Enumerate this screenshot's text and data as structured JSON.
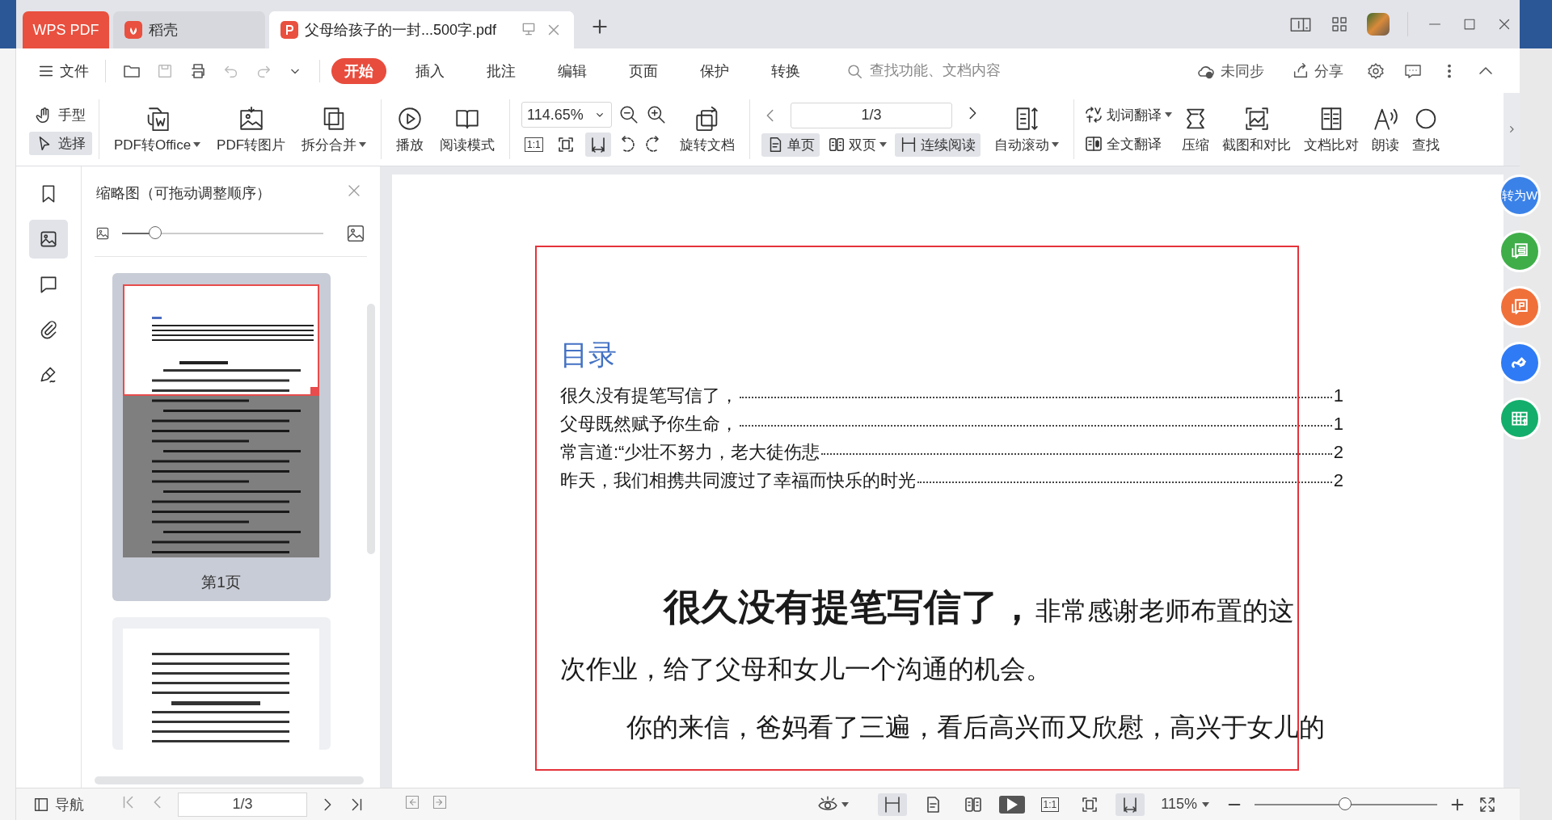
{
  "tabs": [
    {
      "kind": "brand",
      "label": "WPS PDF",
      "selected": false
    },
    {
      "kind": "store",
      "label": "稻壳",
      "selected": false
    },
    {
      "kind": "document",
      "label": "父母给孩子的一封...500字.pdf",
      "selected": true
    }
  ],
  "menu": {
    "file": "文件",
    "ribbon_tabs": [
      {
        "label": "开始",
        "selected": true
      },
      {
        "label": "插入",
        "selected": false
      },
      {
        "label": "批注",
        "selected": false
      },
      {
        "label": "编辑",
        "selected": false
      },
      {
        "label": "页面",
        "selected": false
      },
      {
        "label": "保护",
        "selected": false
      },
      {
        "label": "转换",
        "selected": false
      }
    ],
    "search": {
      "placeholder": "查找功能、文档内容"
    },
    "sync": "未同步",
    "share": "分享"
  },
  "toolbar": {
    "modes": [
      {
        "kind": "hand",
        "label": "手型",
        "selected": false
      },
      {
        "kind": "select",
        "label": "选择",
        "selected": true
      }
    ],
    "tools": [
      {
        "kind": "to-office",
        "label": "PDF转Office",
        "dropdown": true
      },
      {
        "kind": "to-image",
        "label": "PDF转图片",
        "dropdown": false
      },
      {
        "kind": "split",
        "label": "拆分合并",
        "dropdown": true
      },
      {
        "kind": "play",
        "label": "播放",
        "dropdown": false
      },
      {
        "kind": "read",
        "label": "阅读模式",
        "dropdown": false
      }
    ],
    "zoom": "114.65%",
    "fit_buttons": [
      {
        "kind": "actual",
        "label": "1:1",
        "selected": false
      },
      {
        "kind": "fit-page",
        "selected": false
      },
      {
        "kind": "fit-width",
        "selected": true
      }
    ],
    "rotate": "旋转文档",
    "page": "1/3",
    "view_modes": [
      {
        "kind": "single",
        "label": "单页",
        "selected": true,
        "dropdown": false
      },
      {
        "kind": "double",
        "label": "双页",
        "selected": false,
        "dropdown": true
      },
      {
        "kind": "continuous",
        "label": "连续阅读",
        "selected": true,
        "dropdown": false
      }
    ],
    "auto_scroll": "自动滚动",
    "translate": [
      {
        "kind": "word",
        "label": "划词翻译",
        "dropdown": true
      },
      {
        "kind": "full",
        "label": "全文翻译",
        "dropdown": false
      }
    ],
    "right_tools": [
      {
        "kind": "compress",
        "label": "压缩"
      },
      {
        "kind": "screenshot",
        "label": "截图和对比"
      },
      {
        "kind": "compare",
        "label": "文档比对"
      },
      {
        "kind": "read-aloud",
        "label": "朗读"
      },
      {
        "kind": "find",
        "label": "查找"
      }
    ]
  },
  "sidebar": {
    "rail": [
      {
        "kind": "bookmark",
        "selected": false
      },
      {
        "kind": "thumbnail",
        "selected": true
      },
      {
        "kind": "comment",
        "selected": false
      },
      {
        "kind": "attachment",
        "selected": false
      },
      {
        "kind": "sign",
        "selected": false
      }
    ],
    "title": "缩略图（可拖动调整顺序）",
    "size_slider": {
      "level": 0.17
    },
    "thumbnails": [
      {
        "label": "第1页",
        "selected": true
      },
      {
        "selected": false
      }
    ]
  },
  "document": {
    "toc_title": "目录",
    "toc": [
      {
        "text": "很久没有提笔写信了，",
        "page": "1"
      },
      {
        "text": "父母既然赋予你生命，",
        "page": "1"
      },
      {
        "text": "常言道:“少壮不努力，老大徒伤悲",
        "page": "2"
      },
      {
        "text": "昨天，我们相携共同渡过了幸福而快乐的时光",
        "page": "2"
      }
    ],
    "paragraphs": [
      "**很久没有提笔写信了，**非常感谢老师布置的这次作业，给了父母和女儿一个沟通的机会。",
      "你的来信，爸妈看了三遍，看后高兴而又欣慰，高兴于女儿的"
    ]
  },
  "floating_buttons": [
    {
      "kind": "text",
      "label": "转为W",
      "color": "#3b82e8"
    },
    {
      "kind": "sheet",
      "color": "#3fae49"
    },
    {
      "kind": "slides",
      "color": "#f0703a"
    },
    {
      "kind": "link",
      "color": "#2f7bf5"
    },
    {
      "kind": "table",
      "color": "#13ae6b"
    }
  ],
  "status_bar": {
    "nav": "导航",
    "page": "1/3",
    "view_buttons": [
      {
        "kind": "continuous",
        "selected": true
      },
      {
        "kind": "single",
        "selected": false
      },
      {
        "kind": "double",
        "selected": false
      }
    ],
    "fit_buttons": [
      {
        "kind": "actual",
        "label": "1:1",
        "selected": false
      },
      {
        "kind": "fit-page",
        "selected": false
      },
      {
        "kind": "fit-width",
        "selected": true
      }
    ],
    "zoom": "115%",
    "zoom_slider": {
      "level": 0.5
    }
  }
}
